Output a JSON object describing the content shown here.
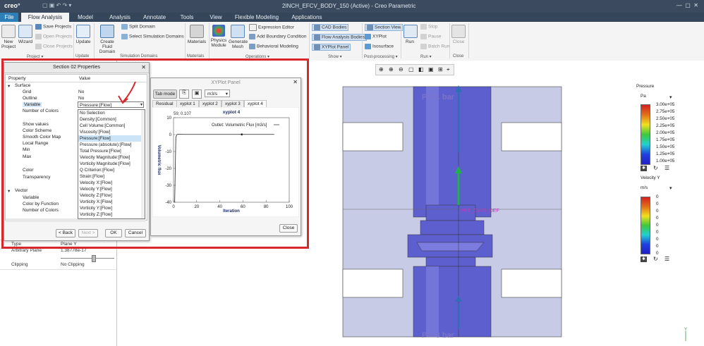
{
  "titlebar": {
    "logo": "creo°",
    "document": "2INCH_EFCV_BODY_150 (Active) - Creo Parametric"
  },
  "tabs": [
    {
      "label": "File"
    },
    {
      "label": "Flow Analysis"
    },
    {
      "label": "Model"
    },
    {
      "label": "Analysis"
    },
    {
      "label": "Annotate"
    },
    {
      "label": "Tools"
    },
    {
      "label": "View"
    },
    {
      "label": "Flexible Modeling"
    },
    {
      "label": "Applications"
    }
  ],
  "ribbon": {
    "new_project": "New Project",
    "wizard": "Wizard",
    "save_projects": "Save Projects",
    "open_projects": "Open Projects",
    "close_projects": "Close Projects",
    "project_group": "Project ▾",
    "update": "Update",
    "update_group": "Update",
    "create_fluid_domain": "Create Fluid Domain",
    "split_domain": "Split Domain",
    "select_simulation_domains": "Select Simulation Domains",
    "simulation_domains_group": "Simulation Domains",
    "materials": "Materials",
    "materials_group": "Materials",
    "physics_module": "Physics Module",
    "generate_mesh": "Generate Mesh",
    "expression_editor": "Expression Editor",
    "add_boundary_condition": "Add Boundary Condition",
    "behavioral_modeling": "Behavioral Modeling",
    "operations_group": "Operations ▾",
    "cad_bodies": "CAD Bodies",
    "flow_analysis_bodies": "Flow Analysis Bodies",
    "xyplot_panel": "XYPlot Panel",
    "show_group": "Show ▾",
    "section_view": "Section View",
    "xyplot": "XYPlot",
    "isosurface": "Isosurface",
    "postprocessing_group": "Post-processing ▾",
    "run": "Run",
    "stop": "Stop",
    "pause": "Pause",
    "batch_run": "Batch Run",
    "run_group": "Run ▾",
    "close": "Close",
    "close_group": "Close"
  },
  "properties_dialog": {
    "title": "Section 02 Properties",
    "col_property": "Property",
    "col_value": "Value",
    "rows": [
      {
        "label": "Surface",
        "value": ""
      },
      {
        "label": "Grid",
        "value": "No"
      },
      {
        "label": "Outline",
        "value": "No"
      },
      {
        "label": "Variable",
        "value": ""
      },
      {
        "label": "Number of Colors",
        "value": ""
      },
      {
        "label": "Show values",
        "value": ""
      },
      {
        "label": "Color Scheme",
        "value": ""
      },
      {
        "label": "Smooth Color Map",
        "value": ""
      },
      {
        "label": "Local Range",
        "value": ""
      },
      {
        "label": "Min",
        "value": ""
      },
      {
        "label": "Max",
        "value": ""
      },
      {
        "label": "Color",
        "value": ""
      },
      {
        "label": "Transparency",
        "value": ""
      },
      {
        "label": "Vector",
        "value": ""
      },
      {
        "label": "Variable",
        "value": ""
      },
      {
        "label": "Color by Function",
        "value": ""
      },
      {
        "label": "Number of Colors",
        "value": ""
      }
    ],
    "selected_variable": "Pressure:[Flow]",
    "dropdown_options": [
      "No Selection",
      "Density:[Common]",
      "Cell Volume:[Common]",
      "Viscosity:[Flow]",
      "Pressure:[Flow]",
      "Pressure (absolute):[Flow]",
      "Total Pressure:[Flow]",
      "Velocity Magnitude:[Flow]",
      "Vorticity Magnitude:[Flow]",
      "Q Criterion:[Flow]",
      "Strain:[Flow]",
      "Velocity X:[Flow]",
      "Velocity Y:[Flow]",
      "Velocity Z:[Flow]",
      "Vorticity X:[Flow]",
      "Vorticity Y:[Flow]",
      "Vorticity Z:[Flow]"
    ],
    "back_btn": "< Back",
    "next_btn": "Next >",
    "ok_btn": "OK",
    "cancel_btn": "Cancel"
  },
  "xyplot_panel": {
    "title": "XYPlot Panel",
    "tab_mode": "Tab mode",
    "unit": "m3/s",
    "tabs": [
      "Residual",
      "xyplot 1",
      "xyplot 2",
      "xyplot 3",
      "xyplot 4"
    ],
    "close_btn": "Close"
  },
  "chart_data": {
    "type": "line",
    "title": "xyplot 4",
    "readout": "59; 0.107",
    "legend": "Outlet: Volumetric Flux [m3/s]",
    "xlabel": "Iteration",
    "ylabel": "Volumetric flux",
    "xlim": [
      0,
      100
    ],
    "ylim": [
      -40,
      10
    ],
    "xticks": [
      "0",
      "20",
      "40",
      "60",
      "80",
      "100"
    ],
    "yticks": [
      "10",
      "0",
      "-10",
      "-20",
      "-30",
      "-40"
    ],
    "series": [
      {
        "name": "Outlet: Volumetric Flux [m3/s]",
        "x": [
          1,
          2,
          3,
          5,
          10,
          20,
          30,
          40,
          50,
          59,
          70,
          80,
          87
        ],
        "y": [
          -40,
          -1.5,
          0.1,
          0.2,
          0.1,
          0.1,
          0.1,
          0.1,
          0.1,
          0.107,
          0.1,
          0.1,
          0.1
        ]
      }
    ]
  },
  "left_panel": {
    "type_label": "Type",
    "type_value": "Plane Y",
    "plane_label": "Arbitrary Plane",
    "plane_value": "1.38778e-17",
    "clipping_label": "Clipping",
    "clipping_value": "No Clipping"
  },
  "viewport": {
    "top_label": "P = 1 bar",
    "bottom_label": "P = 3 bar",
    "csys_label": "PRT_CSYS_DEF"
  },
  "legend_pressure": {
    "title": "Pressure",
    "unit": "Pa",
    "values": [
      "3.00e+05",
      "2.75e+05",
      "2.50e+05",
      "2.25e+05",
      "2.00e+05",
      "1.75e+05",
      "1.50e+05",
      "1.25e+05",
      "1.00e+05"
    ]
  },
  "legend_velocity": {
    "title": "Velocity Y",
    "unit": "m/s",
    "values": [
      "0",
      "0",
      "0",
      "0",
      "0",
      "0",
      "0",
      "0",
      "0"
    ]
  },
  "colors": {
    "accent_red": "#d9272e",
    "file_tab": "#2c7fb8",
    "arrow_blue": "#2f6fb5",
    "arrow_green": "#1fb24a",
    "body_purple": "#5e5fcf"
  }
}
